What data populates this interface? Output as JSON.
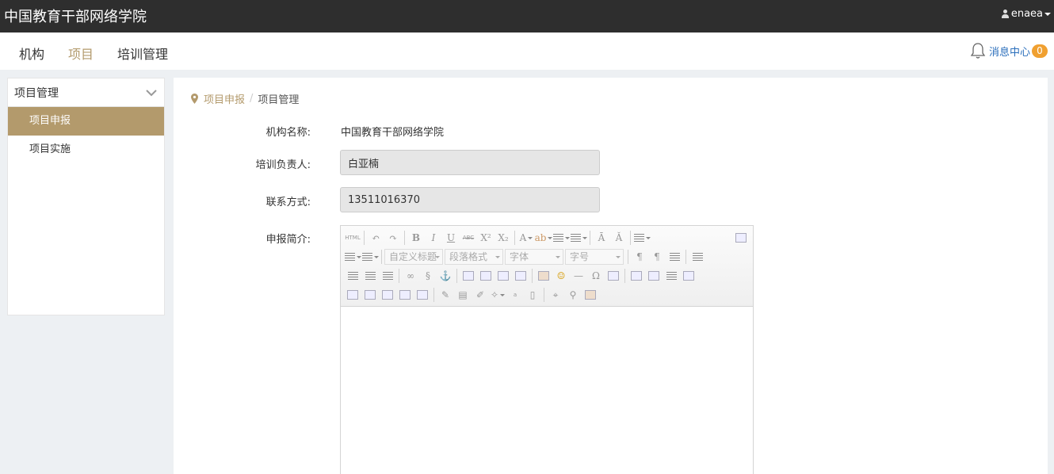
{
  "topbar": {
    "site_title": "中国教育干部网络学院",
    "username": "enaea"
  },
  "nav": {
    "items": [
      "机构",
      "项目",
      "培训管理"
    ],
    "active_index": 1,
    "message_center_label": "消息中心",
    "message_count": "0"
  },
  "sidebar": {
    "header": "项目管理",
    "items": [
      "项目申报",
      "项目实施"
    ],
    "active_index": 0
  },
  "breadcrumb": {
    "link": "项目申报",
    "current": "项目管理"
  },
  "form": {
    "org_name_label": "机构名称:",
    "org_name_value": "中国教育干部网络学院",
    "contact_person_label": "培训负责人:",
    "contact_person_value": "白亚楠",
    "contact_phone_label": "联系方式:",
    "contact_phone_value": "13511016370",
    "intro_label": "申报简介:"
  },
  "editor": {
    "html_btn": "HTML",
    "selects": {
      "custom_title": "自定义标题",
      "paragraph": "段落格式",
      "font_family": "字体",
      "font_size": "字号"
    }
  },
  "colors": {
    "accent": "#b39a6c",
    "topbar": "#2e2e2e",
    "link": "#2a6ebb",
    "badge": "#f0a030"
  }
}
